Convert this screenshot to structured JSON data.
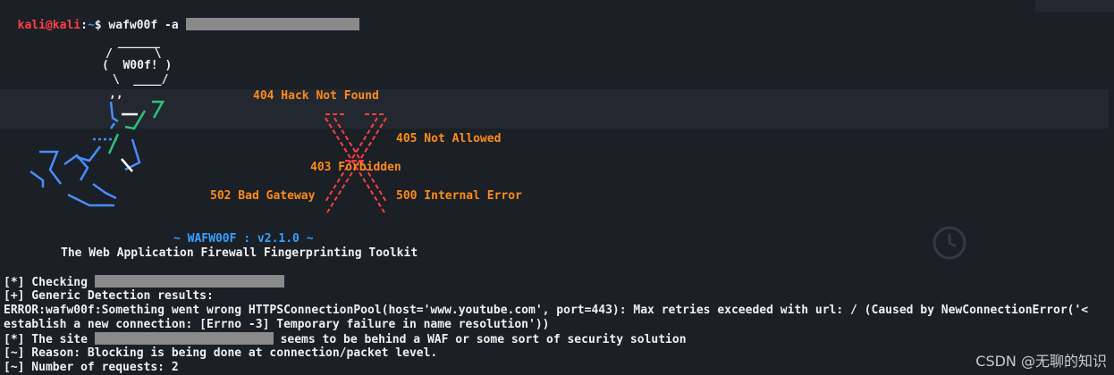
{
  "prompt": {
    "user_host": "kali@kali",
    "sep": ":",
    "path": "~",
    "dollar": "$",
    "command": "wafw00f -a"
  },
  "banner": {
    "woof_top": " ______",
    "woof_line2": "/      \\",
    "woof_label": "(  W00f! )",
    "woof_line4": " \\  ____/",
    "comma": ",,",
    "version": "~ WAFW00F : v2.1.0 ~",
    "tagline": "The Web Application Firewall Fingerprinting Toolkit"
  },
  "status_codes": {
    "c404": "404 Hack Not Found",
    "c405": "405 Not Allowed",
    "c403": "403 Forbidden",
    "c502": "502 Bad Gateway",
    "c500": "500 Internal Error"
  },
  "output": {
    "checking": "[*] Checking",
    "generic": "[+] Generic Detection results:",
    "error1": "ERROR:wafw00f:Something went wrong HTTPSConnectionPool(host='www.youtube.com', port=443): Max retries exceeded with url: / (Caused by NewConnectionError('<",
    "error2": "establish a new connection: [Errno -3] Temporary failure in name resolution'))",
    "site_prefix": "[*] The site",
    "site_suffix": "seems to be behind a WAF or some sort of security solution",
    "reason": "[~] Reason: Blocking is being done at connection/packet level.",
    "requests": "[~] Number of requests: 2"
  },
  "watermark": "CSDN @无聊的知识",
  "colors": {
    "background": "#1b1f26",
    "prompt_red": "#ff4040",
    "path_blue": "#4a8cff",
    "status_orange": "#ff8c1a",
    "redaction_gray": "#8a8a8a"
  }
}
